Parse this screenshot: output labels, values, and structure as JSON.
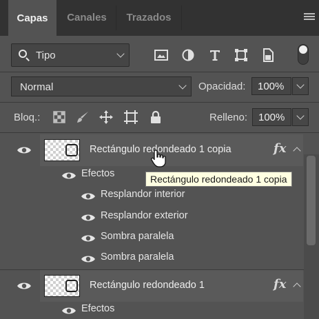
{
  "tabs": [
    {
      "label": "Capas",
      "active": true
    },
    {
      "label": "Canales",
      "active": false
    },
    {
      "label": "Trazados",
      "active": false
    }
  ],
  "filter": {
    "label": "Tipo",
    "icon": "search-icon"
  },
  "filter_buttons": [
    "image-filter-icon",
    "adjustment-filter-icon",
    "text-filter-icon",
    "shape-filter-icon",
    "smart-object-filter-icon"
  ],
  "blend": {
    "mode": "Normal",
    "opacity_label": "Opacidad:",
    "opacity_value": "100%"
  },
  "lock": {
    "label": "Bloq.:",
    "fill_label": "Relleno:",
    "fill_value": "100%"
  },
  "layers": [
    {
      "name": "Rectángulo redondeado 1 copia",
      "fx": "fx",
      "effects_label": "Efectos",
      "effects": [
        "Resplandor interior",
        "Resplandor exterior",
        "Sombra paralela",
        "Sombra paralela"
      ]
    },
    {
      "name": "Rectángulo redondeado 1",
      "fx": "fx",
      "effects_label": "Efectos"
    }
  ],
  "tooltip": "Rectángulo redondeado 1 copia",
  "colors": {
    "panel": "#535353",
    "topbar": "#323232",
    "tooltip_bg": "#ffffe1"
  }
}
